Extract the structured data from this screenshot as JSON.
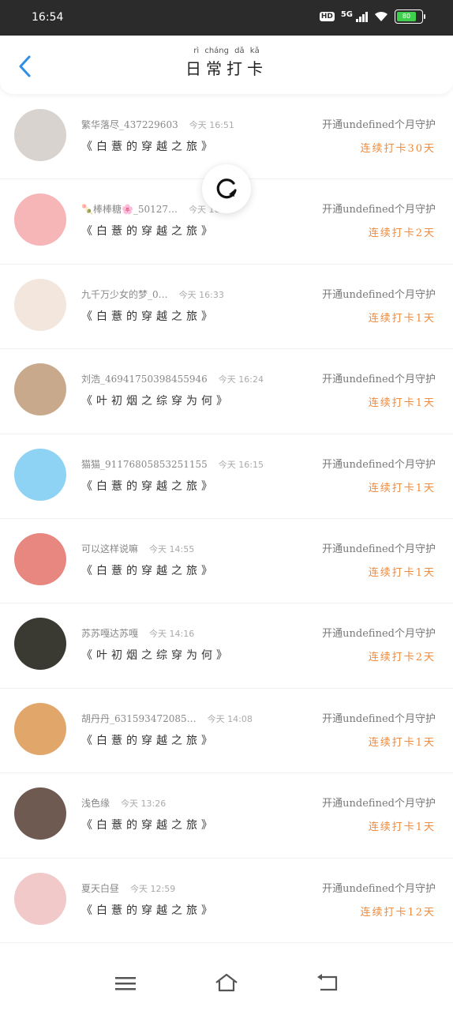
{
  "status_bar": {
    "time": "16:54",
    "network": "5G",
    "hd": "HD",
    "battery": "80"
  },
  "header": {
    "title": "日常打卡",
    "title_pinyin": "rì cháng dǎ kǎ"
  },
  "records": [
    {
      "nickname": "繁华落尽_437229603",
      "time": "今天 16:51",
      "book": "《白薏的穿越之旅》",
      "guard": "开通undefined个月守护",
      "streak": "连续打卡30天",
      "avatar_color": "#d9d3cf"
    },
    {
      "nickname": "🍡棒棒糖🌸_50127…",
      "time": "今天 16:47",
      "book": "《白薏的穿越之旅》",
      "guard": "开通undefined个月守护",
      "streak": "连续打卡2天",
      "avatar_color": "#f6b6b8"
    },
    {
      "nickname": "九千万少女的梦_0…",
      "time": "今天 16:33",
      "book": "《白薏的穿越之旅》",
      "guard": "开通undefined个月守护",
      "streak": "连续打卡1天",
      "avatar_color": "#f3e6dc"
    },
    {
      "nickname": "刘浩_469417503984559​46",
      "time": "今天 16:24",
      "book": "《叶初烟之综穿为何》",
      "guard": "开通undefined个月守护",
      "streak": "连续打卡1天",
      "avatar_color": "#c9a98c"
    },
    {
      "nickname": "猫猫_91176805853251155",
      "time": "今天 16:15",
      "book": "《白薏的穿越之旅》",
      "guard": "开通undefined个月守护",
      "streak": "连续打卡1天",
      "avatar_color": "#8fd3f4"
    },
    {
      "nickname": "可以这样说嘛",
      "time": "今天 14:55",
      "book": "《白薏的穿越之旅》",
      "guard": "开通undefined个月守护",
      "streak": "连续打卡1天",
      "avatar_color": "#e8877f"
    },
    {
      "nickname": "苏苏嘎达苏嘎",
      "time": "今天 14:16",
      "book": "《叶初烟之综穿为何》",
      "guard": "开通undefined个月守护",
      "streak": "连续打卡2天",
      "avatar_color": "#3b3a32"
    },
    {
      "nickname": "胡丹丹_631593472085…",
      "time": "今天 14:08",
      "book": "《白薏的穿越之旅》",
      "guard": "开通undefined个月守护",
      "streak": "连续打卡1天",
      "avatar_color": "#e1a66a"
    },
    {
      "nickname": "浅色缘",
      "time": "今天 13:26",
      "book": "《白薏的穿越之旅》",
      "guard": "开通undefined个月守护",
      "streak": "连续打卡1天",
      "avatar_color": "#6f5a52"
    },
    {
      "nickname": "夏天白昼",
      "time": "今天 12:59",
      "book": "《白薏的穿越之旅》",
      "guard": "开通undefined个月守护",
      "streak": "连续打卡12天",
      "avatar_color": "#f1c9c9"
    }
  ]
}
